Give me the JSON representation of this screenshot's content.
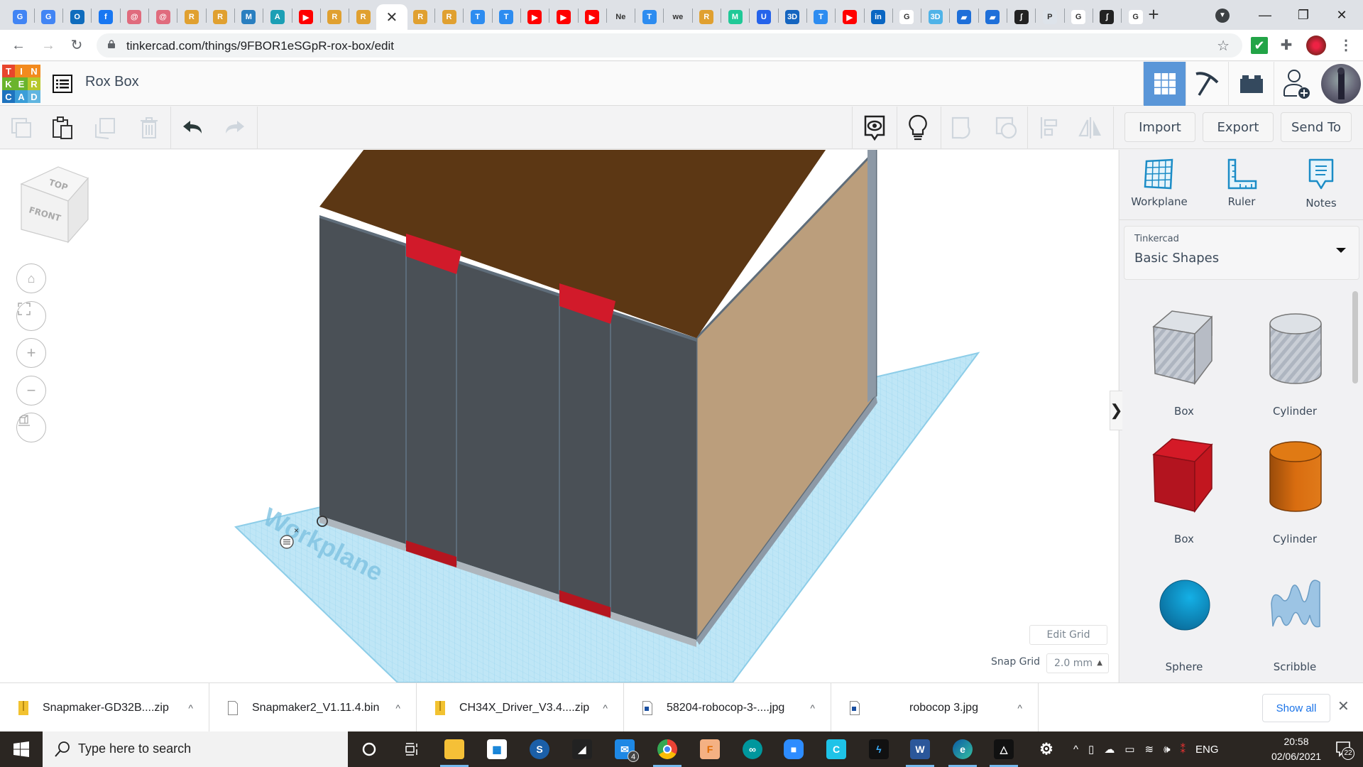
{
  "browser": {
    "tabs": [
      {
        "icon": "google-translate-icon",
        "color": "#4285f4",
        "glyph": "G"
      },
      {
        "icon": "google-translate-icon",
        "color": "#4285f4",
        "glyph": "G"
      },
      {
        "icon": "outlook-icon",
        "color": "#0f6cbd",
        "glyph": "O"
      },
      {
        "icon": "facebook-icon",
        "color": "#1877f2",
        "glyph": "f"
      },
      {
        "icon": "rose-icon",
        "color": "#e06b7d",
        "glyph": "@"
      },
      {
        "icon": "rose-icon",
        "color": "#e06b7d",
        "glyph": "@"
      },
      {
        "icon": "robot-icon",
        "color": "#e0a030",
        "glyph": "R"
      },
      {
        "icon": "robot-icon",
        "color": "#e0a030",
        "glyph": "R"
      },
      {
        "icon": "makerbot-icon",
        "color": "#2a7fc0",
        "glyph": "M"
      },
      {
        "icon": "autodesk-icon",
        "color": "#1c9fb5",
        "glyph": "A"
      },
      {
        "icon": "youtube-icon",
        "color": "#ff0000",
        "glyph": "▶"
      },
      {
        "icon": "robot-icon",
        "color": "#e0a030",
        "glyph": "R"
      },
      {
        "icon": "robot-icon",
        "color": "#e0a030",
        "glyph": "R"
      },
      {
        "icon": "close-icon",
        "color": "#ffffff",
        "glyph": "✕",
        "active": true
      },
      {
        "icon": "robot-icon",
        "color": "#e0a030",
        "glyph": "R"
      },
      {
        "icon": "robot-icon",
        "color": "#e0a030",
        "glyph": "R"
      },
      {
        "icon": "t-icon",
        "color": "#2d8cf0",
        "glyph": "T"
      },
      {
        "icon": "t-icon",
        "color": "#2d8cf0",
        "glyph": "T"
      },
      {
        "icon": "youtube-icon",
        "color": "#ff0000",
        "glyph": "▶"
      },
      {
        "icon": "youtube-icon",
        "color": "#ff0000",
        "glyph": "▶"
      },
      {
        "icon": "youtube-icon",
        "color": "#ff0000",
        "glyph": "▶"
      },
      {
        "icon": "ne-icon",
        "color": "#dee1e6",
        "glyph": "Ne"
      },
      {
        "icon": "t-icon",
        "color": "#2d8cf0",
        "glyph": "T"
      },
      {
        "icon": "we-icon",
        "color": "#dee1e6",
        "glyph": "we"
      },
      {
        "icon": "robot-icon",
        "color": "#e0a030",
        "glyph": "R"
      },
      {
        "icon": "m-icon",
        "color": "#20c997",
        "glyph": "M"
      },
      {
        "icon": "u-icon",
        "color": "#2563eb",
        "glyph": "U"
      },
      {
        "icon": "3d-icon",
        "color": "#1565c0",
        "glyph": "3D"
      },
      {
        "icon": "t-icon",
        "color": "#2d8cf0",
        "glyph": "T"
      },
      {
        "icon": "youtube-icon",
        "color": "#ff0000",
        "glyph": "▶"
      },
      {
        "icon": "linkedin-icon",
        "color": "#0a66c2",
        "glyph": "in"
      },
      {
        "icon": "google-icon",
        "color": "#ffffff",
        "glyph": "G"
      },
      {
        "icon": "robot3d-icon",
        "color": "#4fb3e8",
        "glyph": "3D"
      },
      {
        "icon": "book-icon",
        "color": "#1e6fd9",
        "glyph": "▰"
      },
      {
        "icon": "book-icon",
        "color": "#1e6fd9",
        "glyph": "▰"
      },
      {
        "icon": "integral-icon",
        "color": "#222222",
        "glyph": "∫"
      },
      {
        "icon": "printer-icon",
        "color": "#dde3ea",
        "glyph": "P"
      },
      {
        "icon": "google-icon",
        "color": "#ffffff",
        "glyph": "G"
      },
      {
        "icon": "integral-icon",
        "color": "#222222",
        "glyph": "∫"
      },
      {
        "icon": "google-icon",
        "color": "#ffffff",
        "glyph": "G"
      }
    ],
    "new_tab": "+",
    "url": "tinkercad.com/things/9FBOR1eSGpR-rox-box/edit"
  },
  "app": {
    "logo_letters": [
      "T",
      "I",
      "N",
      "K",
      "E",
      "R",
      "C",
      "A",
      "D"
    ],
    "logo_colors": [
      "#e8452c",
      "#f28a1e",
      "#f28a1e",
      "#6ab42d",
      "#6ab42d",
      "#b7c72a",
      "#1e73be",
      "#3b9ed8",
      "#60b5e0"
    ],
    "design_title": "Rox Box",
    "accent": "#5a96d8"
  },
  "toolbar": {
    "import": "Import",
    "export": "Export",
    "send_to": "Send To"
  },
  "viewcube": {
    "top": "TOP",
    "front": "FRONT"
  },
  "workplane_label": "Workplane",
  "grid": {
    "edit_grid": "Edit Grid",
    "snap_label": "Snap Grid",
    "snap_value": "2.0 mm"
  },
  "right_panel": {
    "tools": [
      {
        "label": "Workplane"
      },
      {
        "label": "Ruler"
      },
      {
        "label": "Notes"
      }
    ],
    "library_source": "Tinkercad",
    "library_name": "Basic Shapes",
    "shapes": [
      {
        "label": "Box",
        "kind": "box-hole"
      },
      {
        "label": "Cylinder",
        "kind": "cylinder-hole"
      },
      {
        "label": "Box",
        "kind": "box-solid"
      },
      {
        "label": "Cylinder",
        "kind": "cylinder-solid"
      },
      {
        "label": "Sphere",
        "kind": "sphere"
      },
      {
        "label": "Scribble",
        "kind": "scribble"
      }
    ]
  },
  "downloads": {
    "items": [
      {
        "name": "Snapmaker-GD32B....zip",
        "type": "zip"
      },
      {
        "name": "Snapmaker2_V1.11.4.bin",
        "type": "file"
      },
      {
        "name": "CH34X_Driver_V3.4....zip",
        "type": "zip"
      },
      {
        "name": "58204-robocop-3-....jpg",
        "type": "image"
      },
      {
        "name": "robocop 3.jpg",
        "type": "image"
      }
    ],
    "show_all": "Show all"
  },
  "taskbar": {
    "search_placeholder": "Type here to search",
    "mail_badge": "4",
    "language": "ENG",
    "time": "20:58",
    "date": "02/06/2021",
    "notifications": "22"
  }
}
